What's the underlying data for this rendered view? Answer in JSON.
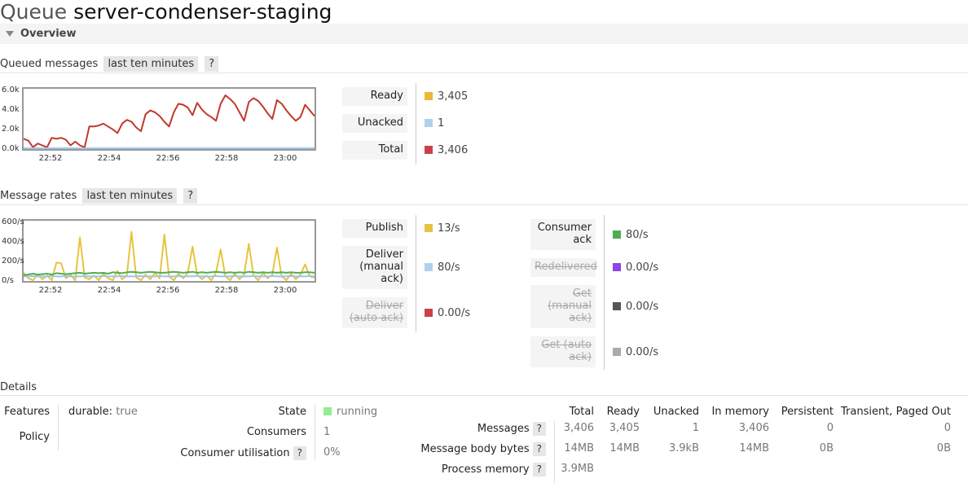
{
  "page": {
    "title_prefix": "Queue",
    "title_name": "server-condenser-staging"
  },
  "overview": {
    "label": "Overview"
  },
  "queued": {
    "heading": "Queued messages",
    "range": "last ten minutes",
    "help": "?",
    "chart": {
      "type": "line",
      "y_ticks": [
        "6.0k",
        "4.0k",
        "2.0k",
        "0.0k"
      ],
      "x_ticks": [
        "22:52",
        "22:54",
        "22:56",
        "22:58",
        "23:00"
      ],
      "ylim": [
        0,
        6200
      ],
      "series": [
        {
          "name": "Total",
          "color": "#c0392b",
          "values": [
            1000,
            800,
            100,
            500,
            300,
            100,
            1100,
            1000,
            1100,
            900,
            300,
            700,
            300,
            100,
            2300,
            2300,
            2400,
            2600,
            2300,
            2000,
            1600,
            2600,
            3000,
            2800,
            2200,
            1800,
            3600,
            4000,
            3800,
            3400,
            2800,
            2300,
            3800,
            4700,
            4600,
            4300,
            3500,
            4800,
            4100,
            3600,
            3300,
            2900,
            4700,
            5600,
            5200,
            4700,
            3800,
            2900,
            4900,
            5300,
            5000,
            4400,
            3700,
            3100,
            5100,
            4700,
            4000,
            3400,
            2900,
            3300,
            4600,
            4000,
            3400
          ]
        },
        {
          "name": "Unacked",
          "color": "#9fc5e8",
          "values": [
            0,
            0,
            0,
            0,
            0,
            0,
            0,
            0,
            0,
            0,
            0,
            0,
            0,
            0,
            0,
            0,
            0,
            0,
            0,
            0,
            0,
            0,
            0,
            0,
            0,
            0,
            0,
            0,
            0,
            0,
            0,
            0,
            0,
            0,
            0,
            0,
            0,
            0,
            0,
            0,
            0,
            0,
            0,
            0,
            0,
            0,
            0,
            0,
            0,
            0,
            0,
            0,
            0,
            0,
            0,
            0,
            0,
            0,
            0,
            0,
            0,
            0,
            0
          ]
        }
      ]
    },
    "legend": [
      {
        "label": "Ready",
        "value": "3,405",
        "color": "#e8b83a"
      },
      {
        "label": "Unacked",
        "value": "1",
        "color": "#aed1f0"
      },
      {
        "label": "Total",
        "value": "3,406",
        "color": "#c9424a"
      }
    ]
  },
  "rates": {
    "heading": "Message rates",
    "range": "last ten minutes",
    "help": "?",
    "chart": {
      "type": "line",
      "y_ticks": [
        "600/s",
        "400/s",
        "200/s",
        "0/s"
      ],
      "x_ticks": [
        "22:52",
        "22:54",
        "22:56",
        "22:58",
        "23:00"
      ],
      "ylim": [
        0,
        630
      ],
      "series": [
        {
          "name": "Publish",
          "color": "#e8c340",
          "values": [
            80,
            20,
            0,
            60,
            10,
            50,
            0,
            190,
            180,
            20,
            60,
            0,
            460,
            30,
            10,
            50,
            0,
            70,
            20,
            0,
            100,
            10,
            50,
            520,
            30,
            0,
            60,
            10,
            80,
            20,
            490,
            40,
            0,
            70,
            20,
            80,
            360,
            60,
            10,
            50,
            0,
            80,
            330,
            40,
            0,
            70,
            10,
            60,
            390,
            50,
            0,
            80,
            20,
            60,
            350,
            40,
            0,
            70,
            10,
            60,
            170,
            40,
            30
          ]
        },
        {
          "name": "Deliver (manual ack)",
          "color": "#9fc5e8",
          "values": [
            40,
            40,
            45,
            40,
            42,
            40,
            45,
            40,
            40,
            45,
            40,
            42,
            40,
            45,
            40,
            42,
            40,
            45,
            40,
            42,
            40,
            45,
            40,
            42,
            40,
            45,
            40,
            42,
            40,
            45,
            40,
            42,
            40,
            45,
            40,
            42,
            40,
            45,
            40,
            42,
            40,
            45,
            40,
            42,
            40,
            45,
            40,
            42,
            40,
            45,
            40,
            42,
            40,
            45,
            40,
            42,
            40,
            45,
            40,
            42,
            40,
            45,
            40
          ]
        },
        {
          "name": "Consumer ack",
          "color": "#4caf50",
          "values": [
            55,
            60,
            70,
            60,
            65,
            70,
            60,
            75,
            70,
            65,
            70,
            75,
            80,
            70,
            75,
            80,
            75,
            80,
            70,
            85,
            80,
            75,
            85,
            90,
            85,
            80,
            85,
            90,
            85,
            80,
            80,
            85,
            90,
            85,
            80,
            85,
            90,
            80,
            85,
            80,
            85,
            90,
            85,
            80,
            85,
            80,
            85,
            80,
            90,
            85,
            80,
            85,
            80,
            85,
            80,
            85,
            80,
            85,
            80,
            80,
            85,
            85,
            80
          ]
        }
      ]
    },
    "legend_left": [
      {
        "label": "Publish",
        "value": "13/s",
        "color": "#e8c340",
        "strike": false
      },
      {
        "label": "Deliver (manual ack)",
        "value": "80/s",
        "color": "#aed1f0",
        "strike": false
      },
      {
        "label": "Deliver (auto ack)",
        "value": "0.00/s",
        "color": "#c9424a",
        "strike": true
      }
    ],
    "legend_right": [
      {
        "label": "Consumer ack",
        "value": "80/s",
        "color": "#4caf50",
        "strike": false
      },
      {
        "label": "Redelivered",
        "value": "0.00/s",
        "color": "#8e44e8",
        "strike": true
      },
      {
        "label": "Get (manual ack)",
        "value": "0.00/s",
        "color": "#555555",
        "strike": true
      },
      {
        "label": "Get (auto ack)",
        "value": "0.00/s",
        "color": "#aaaaaa",
        "strike": true
      }
    ]
  },
  "details": {
    "heading": "Details",
    "features_label": "Features",
    "features_key": "durable:",
    "features_value": "true",
    "policy_label": "Policy",
    "state_label": "State",
    "state_value": "running",
    "state_color": "#90ee90",
    "consumers_label": "Consumers",
    "consumers_value": "1",
    "utilisation_label": "Consumer utilisation",
    "utilisation_value": "0%",
    "help": "?",
    "table": {
      "headers": [
        "Total",
        "Ready",
        "Unacked",
        "In memory",
        "Persistent",
        "Transient, Paged Out"
      ],
      "rows": [
        {
          "label": "Messages",
          "values": [
            "3,406",
            "3,405",
            "1",
            "3,406",
            "0",
            "0"
          ]
        },
        {
          "label": "Message body bytes",
          "values": [
            "14MB",
            "14MB",
            "3.9kB",
            "14MB",
            "0B",
            "0B"
          ]
        },
        {
          "label": "Process memory",
          "values": [
            "3.9MB"
          ]
        }
      ]
    }
  }
}
